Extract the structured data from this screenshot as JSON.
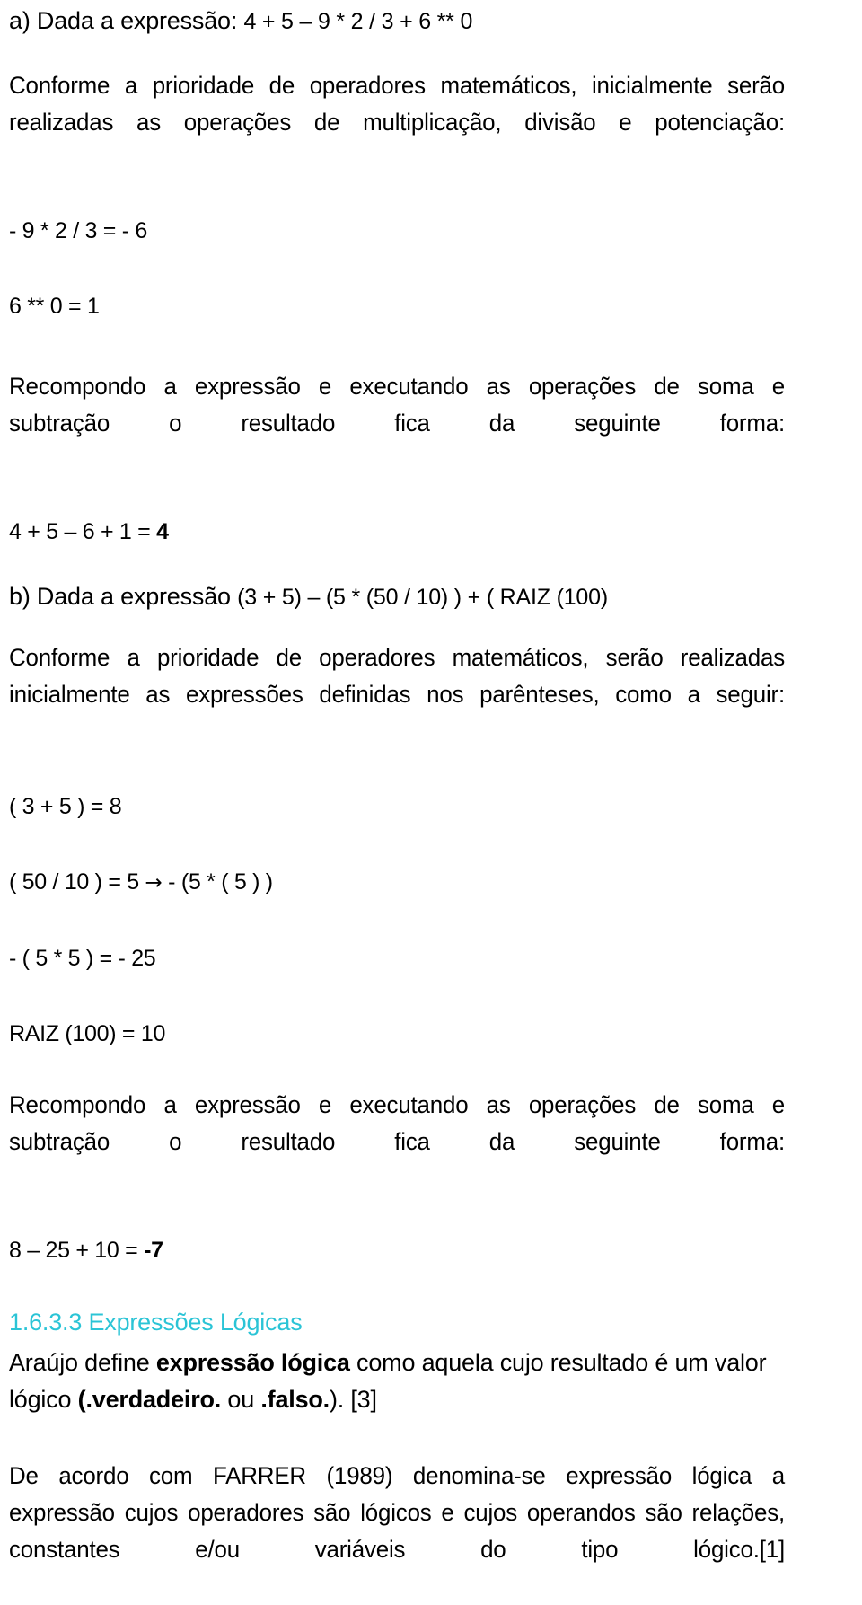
{
  "document": {
    "language": "pt-BR",
    "heading_color": "#2BC4D6",
    "body_color": "#000000"
  },
  "item_a": {
    "label": "a) Dada a expressão: ",
    "expression": "4 + 5 – 9 * 2 / 3 + 6 ** 0",
    "paragraph": "Conforme a prioridade de operadores matemáticos, inicialmente serão realizadas as operações de multiplicação, divisão e potenciação:",
    "step_1": "- 9 * 2 / 3 = - 6",
    "step_2": "6 ** 0 = 1",
    "recompose_paragraph": "Recompondo a expressão e executando as operações de soma e subtração o resultado fica da seguinte forma:",
    "result_expression": "4 + 5 – 6 + 1 = ",
    "result_value": "4"
  },
  "item_b": {
    "label": "b) Dada a expressão ",
    "expression": "(3 + 5) – (5 * (50 / 10) ) + ( RAIZ (100)",
    "paragraph": "Conforme a prioridade de operadores matemáticos, serão realizadas inicialmente as expressões definidas nos parênteses, como a seguir:",
    "step_1": "( 3 + 5 ) = 8",
    "step_2_left": "( 50 / 10 ) = 5 ",
    "step_2_arrow": "→",
    "step_2_right": " - (5 * ( 5 ) )",
    "step_3": "- ( 5 * 5 ) = - 25",
    "step_4": "RAIZ (100) = 10",
    "recompose_paragraph": "Recompondo a expressão e executando as operações de soma e subtração o resultado fica da seguinte forma:",
    "result_expression": "8 – 25 + 10 = ",
    "result_value": "-7"
  },
  "section": {
    "number": "1.6.3.3",
    "title": "Expressões Lógicas",
    "full_heading": "1.6.3.3 Expressões Lógicas",
    "paragraph_1": {
      "part_1": "Araújo define ",
      "bold_1": "expressão lógica",
      "part_2": " como aquela cujo resultado é um valor lógico ",
      "bold_2": "(.verdadeiro.",
      "part_3": " ou ",
      "bold_3": ".falso.",
      "part_4": "). [3]"
    },
    "paragraph_2": "De acordo com FARRER (1989) denomina-se expressão lógica a expressão cujos operadores são lógicos e cujos operandos são relações, constantes e/ou variáveis do tipo lógico.[1]"
  }
}
